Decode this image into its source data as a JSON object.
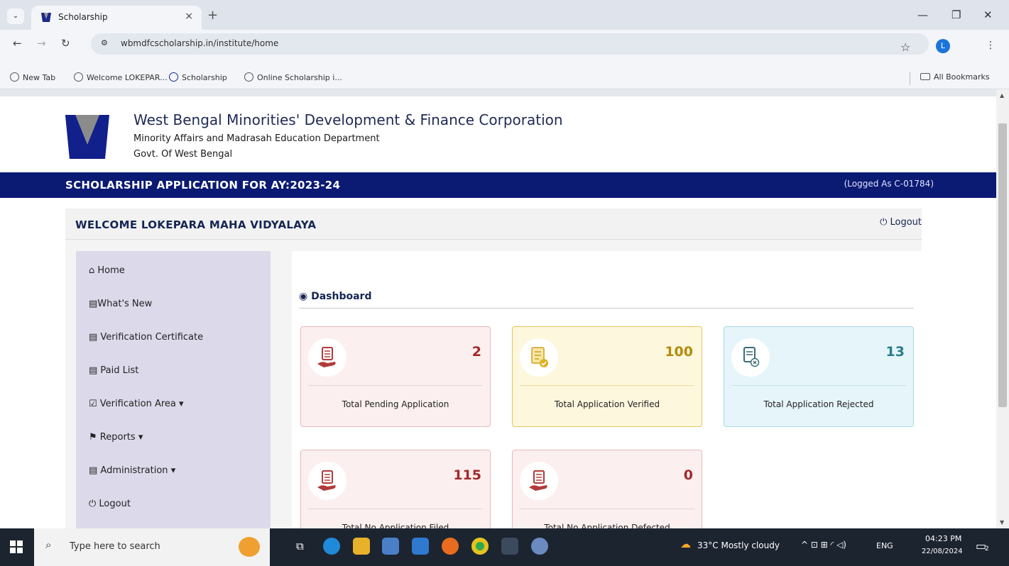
{
  "browser": {
    "tab_title": "Scholarship",
    "tab_close": "×",
    "new_tab": "+",
    "url": "wbmdfcscholarship.in/institute/home",
    "profile_initial": "L",
    "bookmarks": [
      "New Tab",
      "Welcome LOKEPAR...",
      "Scholarship",
      "Online Scholarship i..."
    ],
    "all_bookmarks": "All Bookmarks"
  },
  "header": {
    "org_name": "West Bengal Minorities' Development & Finance Corporation",
    "department": "Minority Affairs and Madrasah Education Department",
    "govt": "Govt. Of West Bengal",
    "banner_title": "SCHOLARSHIP APPLICATION FOR AY:2023-24",
    "logged_as": "(Logged As C-01784)"
  },
  "welcome": {
    "text": "WELCOME LOKEPARA MAHA VIDYALAYA",
    "logout": "Logout"
  },
  "sidebar": {
    "items": [
      {
        "icon": "home-icon",
        "label": "Home"
      },
      {
        "icon": "news-icon",
        "label": "What's New"
      },
      {
        "icon": "document-icon",
        "label": "Verification Certificate"
      },
      {
        "icon": "document-icon",
        "label": "Paid List"
      },
      {
        "icon": "checkbox-icon",
        "label": "Verification Area",
        "caret": "▾"
      },
      {
        "icon": "flag-icon",
        "label": "Reports",
        "caret": "▾"
      },
      {
        "icon": "document-icon",
        "label": "Administration",
        "caret": "▾"
      },
      {
        "icon": "power-icon",
        "label": "Logout"
      }
    ]
  },
  "dashboard": {
    "title": "Dashboard",
    "cards": [
      {
        "value": "2",
        "label": "Total Pending Application",
        "theme": "red",
        "value_color": "#a12a2a"
      },
      {
        "value": "100",
        "label": "Total Application Verified",
        "theme": "yellow",
        "value_color": "#b58a09"
      },
      {
        "value": "13",
        "label": "Total Application Rejected",
        "theme": "blue",
        "value_color": "#2a7c8c"
      },
      {
        "value": "115",
        "label": "Total No Application Filed",
        "theme": "red",
        "value_color": "#a12a2a"
      },
      {
        "value": "0",
        "label": "Total No Application Defected",
        "theme": "red",
        "value_color": "#a12a2a"
      }
    ]
  },
  "taskbar": {
    "search_placeholder": "Type here to search",
    "weather": "33°C  Mostly cloudy",
    "language": "ENG",
    "time": "04:23 PM",
    "date": "22/08/2024",
    "notifications": "2"
  },
  "colors": {
    "banner": "#0b1a73",
    "sidebar": "#dcdaea",
    "card_red_bg": "#fcefef",
    "card_yellow_bg": "#fdf7dd",
    "card_blue_bg": "#e6f5fa"
  }
}
